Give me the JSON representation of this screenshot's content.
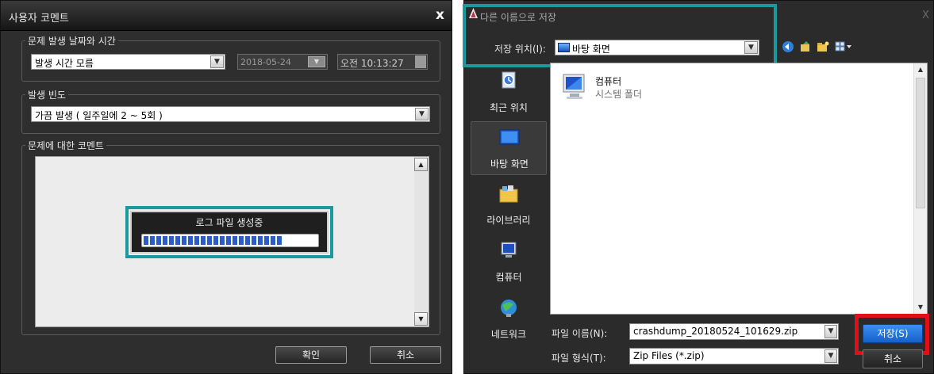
{
  "comment_dialog": {
    "title": "사용자 코멘트",
    "close_glyph": "x",
    "occurrence_group": {
      "label": "문제 발생 날짜와 시간",
      "time_mode": "발생 시간 모름",
      "date": "2018-05-24",
      "time": "오전 10:13:27"
    },
    "frequency_group": {
      "label": "발생 빈도",
      "selected": "가끔 발생 ( 일주일에 2 ~ 5회 )"
    },
    "comment_group": {
      "label": "문제에 대한 코멘트"
    },
    "progress": {
      "title": "로그 파일 생성중",
      "fraction": 0.8
    },
    "buttons": {
      "ok": "확인",
      "cancel": "취소"
    }
  },
  "save_dialog": {
    "title": "다른 이름으로 저장",
    "close_glyph": "X",
    "location": {
      "label": "저장 위치(I):",
      "value": "바탕 화면"
    },
    "places": [
      {
        "label": "최근 위치",
        "icon": "recent-places-icon"
      },
      {
        "label": "바탕 화면",
        "icon": "desktop-icon"
      },
      {
        "label": "라이브러리",
        "icon": "libraries-icon"
      },
      {
        "label": "컴퓨터",
        "icon": "computer-icon"
      },
      {
        "label": "네트워크",
        "icon": "network-icon"
      }
    ],
    "files": [
      {
        "name": "컴퓨터",
        "desc": "시스템 폴더",
        "icon": "computer-icon"
      }
    ],
    "filename": {
      "label": "파일 이름(N):",
      "value": "crashdump_20180524_101629.zip"
    },
    "filetype": {
      "label": "파일 형식(T):",
      "value": "Zip Files (*.zip)"
    },
    "buttons": {
      "save": "저장(S)",
      "cancel": "취소"
    }
  },
  "colors": {
    "highlight_teal": "#1a9a9e",
    "highlight_red": "#e0101a",
    "progress_blue": "#2a5ec4"
  }
}
